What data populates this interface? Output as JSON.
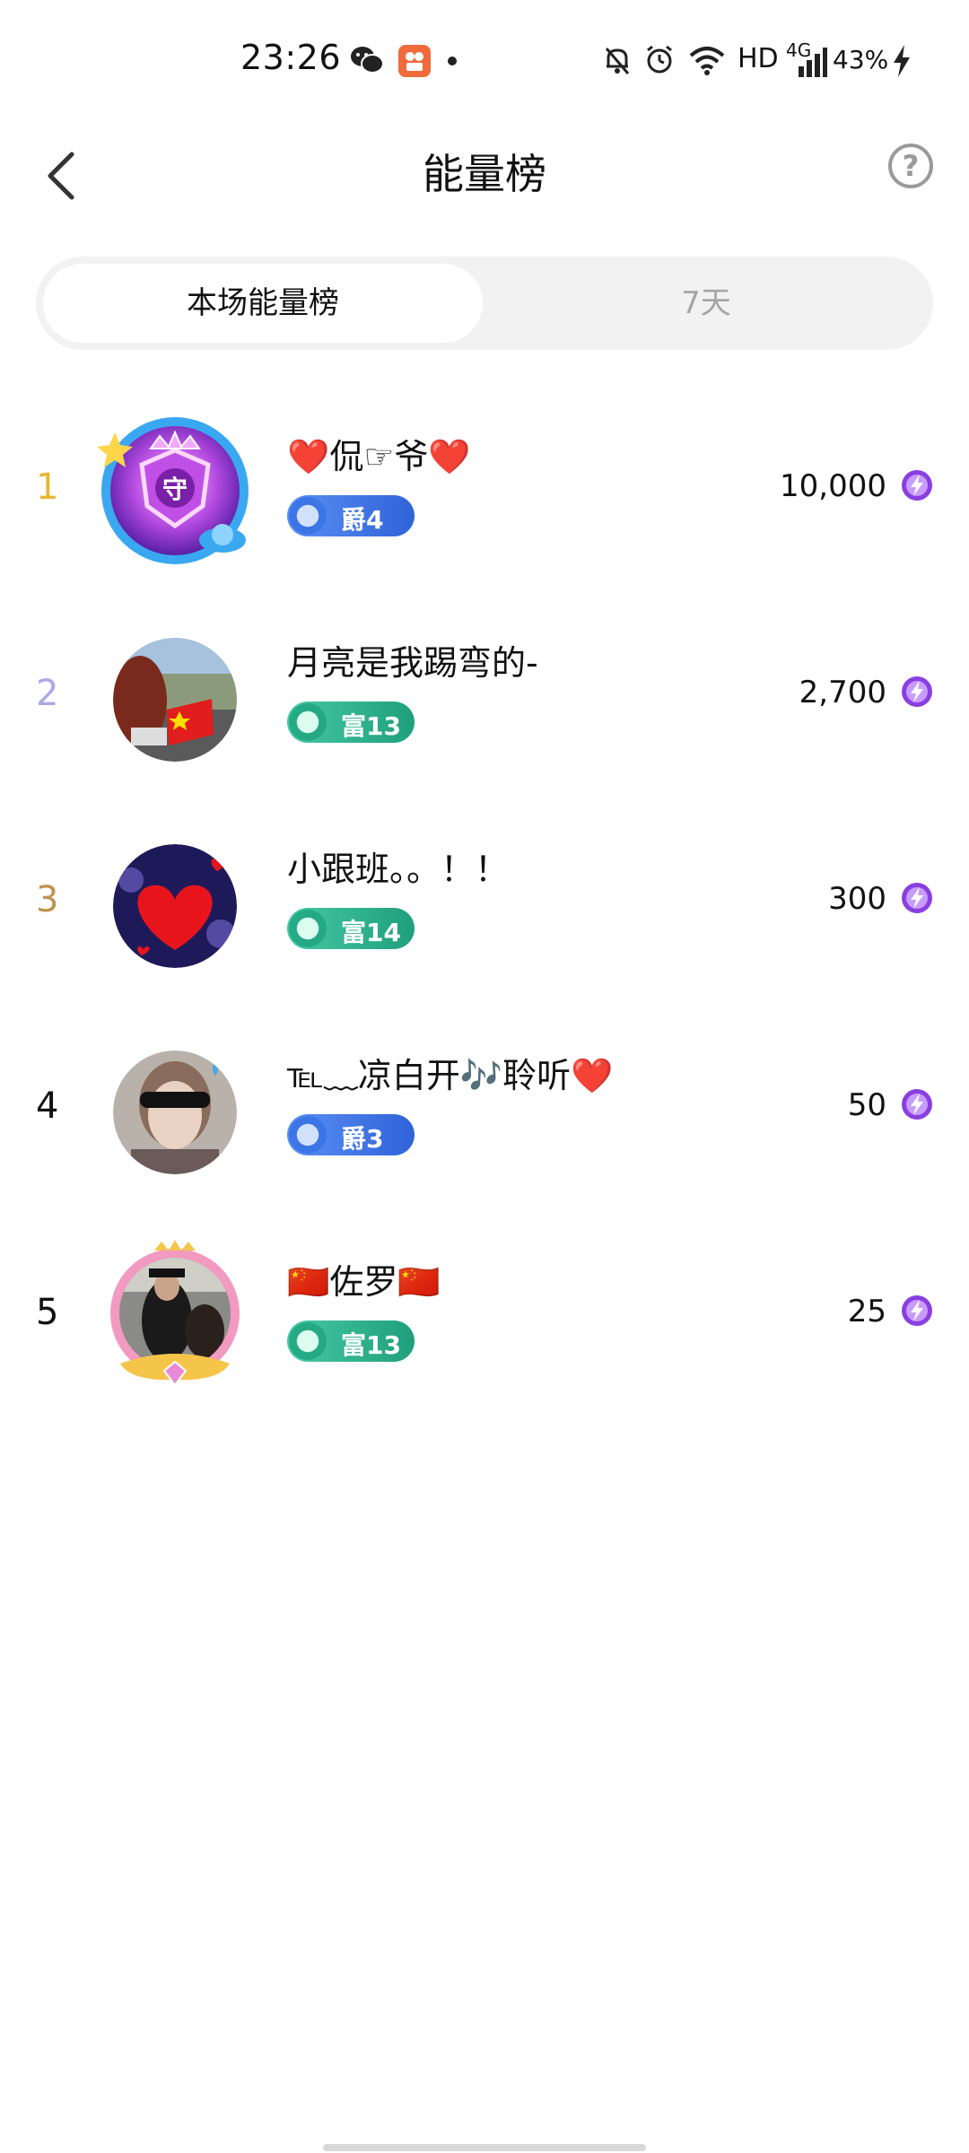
{
  "status_bar": {
    "time": "23:26",
    "network": "HD",
    "signal": "4G",
    "battery": "43%"
  },
  "header": {
    "title": "能量榜",
    "back_icon": "chevron-left-icon",
    "help_icon": "help-circle-icon",
    "help_symbol": "?"
  },
  "tabs": [
    {
      "label": "本场能量榜",
      "active": true
    },
    {
      "label": "7天",
      "active": false
    }
  ],
  "colors": {
    "rank1": "#e8b630",
    "rank2": "#a9a9e6",
    "rank3": "#c0924e",
    "badge_blue": "#3a74e6",
    "badge_green": "#23a882",
    "energy": "#8a3fe0"
  },
  "entries": [
    {
      "rank": "1",
      "name": "❤️侃☞爷❤️",
      "badge": "爵4",
      "badge_type": "blue",
      "score": "10,000"
    },
    {
      "rank": "2",
      "name": "月亮是我踢弯的-",
      "badge": "富13",
      "badge_type": "green",
      "score": "2,700"
    },
    {
      "rank": "3",
      "name": "小跟班。。！！",
      "badge": "富14",
      "badge_type": "green",
      "score": "300"
    },
    {
      "rank": "4",
      "name": "℡﹏凉白开🎶聆听❤️",
      "badge": "爵3",
      "badge_type": "blue",
      "score": "50"
    },
    {
      "rank": "5",
      "name": "🇨🇳佐罗🇨🇳",
      "badge": "富13",
      "badge_type": "green",
      "score": "25"
    }
  ]
}
